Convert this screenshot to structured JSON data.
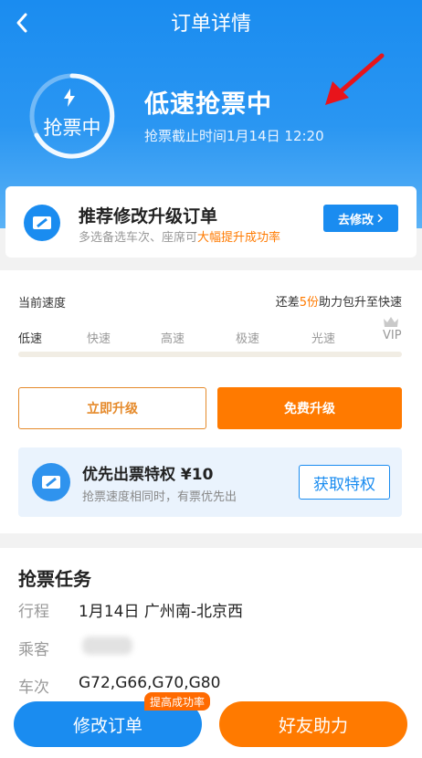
{
  "header": {
    "title": "订单详情"
  },
  "status": {
    "ring_label": "抢票中",
    "title": "低速抢票中",
    "deadline": "抢票截止时间1月14日 12:20"
  },
  "recommend": {
    "title": "推荐修改升级订单",
    "sub_prefix": "多选备选车次、座席可",
    "sub_highlight": "大幅提升成功率",
    "button": "去修改"
  },
  "speed": {
    "current_label": "当前速度",
    "gap_prefix": "还差",
    "gap_count": "5份",
    "gap_suffix": "助力包升至快速",
    "levels": [
      "低速",
      "快速",
      "高速",
      "极速",
      "光速",
      "VIP"
    ],
    "progress": 0.0,
    "upgrade_now": "立即升级",
    "free_upgrade": "免费升级"
  },
  "privilege": {
    "title": "优先出票特权 ¥10",
    "sub": "抢票速度相同时，有票优先出",
    "button": "获取特权"
  },
  "task": {
    "title": "抢票任务",
    "rows": [
      {
        "label": "行程",
        "value": "1月14日 广州南-北京西"
      },
      {
        "label": "乘客",
        "value": ""
      },
      {
        "label": "车次",
        "value": "G72,G66,G70,G80"
      }
    ]
  },
  "bottom": {
    "modify": "修改订单",
    "badge": "提高成功率",
    "friend": "好友助力"
  },
  "colors": {
    "primary": "#1a8cf0",
    "accent": "#ff7a00",
    "annotation": "#e8141b"
  }
}
